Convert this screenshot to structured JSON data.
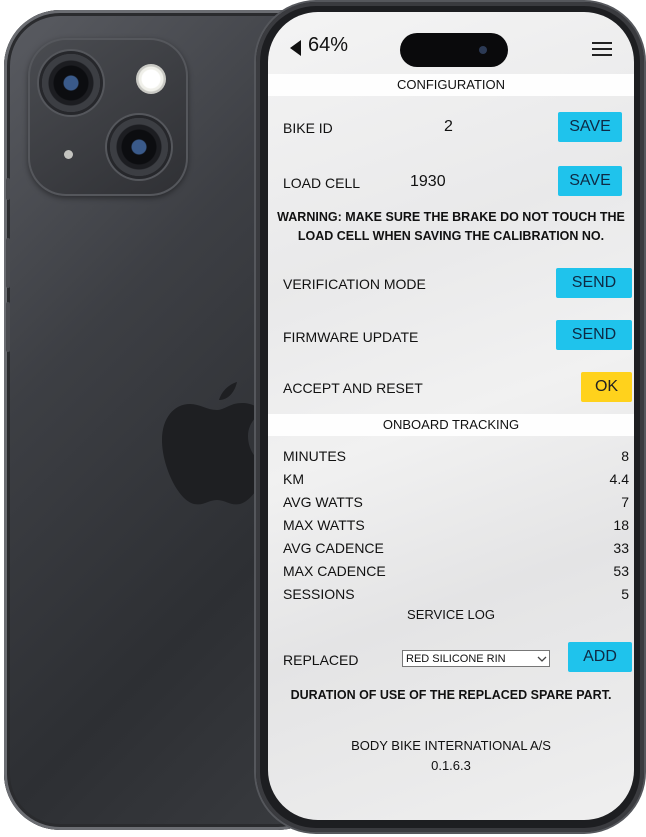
{
  "status": {
    "battery": "64%"
  },
  "configuration": {
    "header": "CONFIGURATION",
    "bike_id": {
      "label": "BIKE ID",
      "value": "2",
      "button": "SAVE"
    },
    "load_cell": {
      "label": "LOAD CELL",
      "value": "1930",
      "button": "SAVE"
    },
    "warning": "WARNING: MAKE SURE THE BRAKE DO NOT TOUCH THE LOAD CELL WHEN SAVING THE CALIBRATION NO.",
    "verification": {
      "label": "VERIFICATION MODE",
      "button": "SEND"
    },
    "firmware": {
      "label": "FIRMWARE UPDATE",
      "button": "SEND"
    },
    "accept": {
      "label": "ACCEPT AND RESET",
      "button": "OK"
    }
  },
  "tracking": {
    "header": "ONBOARD TRACKING",
    "rows": [
      {
        "label": "MINUTES",
        "value": "8"
      },
      {
        "label": "KM",
        "value": "4.4"
      },
      {
        "label": "AVG WATTS",
        "value": "7"
      },
      {
        "label": "MAX WATTS",
        "value": "18"
      },
      {
        "label": "AVG CADENCE",
        "value": "33"
      },
      {
        "label": "MAX CADENCE",
        "value": "53"
      },
      {
        "label": "SESSIONS",
        "value": "5"
      }
    ]
  },
  "service_log": {
    "header": "SERVICE LOG",
    "replaced_label": "REPLACED",
    "selected_part": "RED SILICONE RIN",
    "button": "ADD",
    "note": "DURATION OF USE OF THE REPLACED SPARE PART."
  },
  "footer": {
    "company": "BODY BIKE INTERNATIONAL A/S",
    "version": "0.1.6.3"
  },
  "colors": {
    "send_button": "#1fc3ec",
    "ok_button": "#ffd21c"
  },
  "icons": [
    "back-arrow-icon",
    "menu-icon",
    "chevron-down-icon",
    "apple-logo-icon"
  ]
}
